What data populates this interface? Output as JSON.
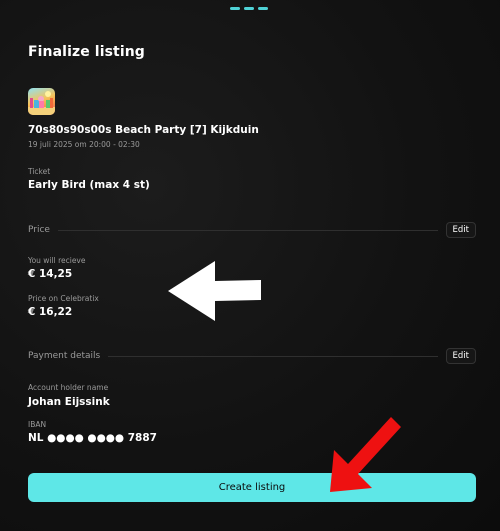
{
  "sheet": {
    "title": "Finalize listing"
  },
  "event": {
    "name": "70s80s90s00s Beach Party [7] Kijkduin",
    "date": "19 juli 2025 om 20:00 - 02:30"
  },
  "ticket": {
    "label": "Ticket",
    "value": "Early Bird (max 4 st)"
  },
  "price": {
    "section_title": "Price",
    "edit_label": "Edit",
    "receive_label": "You will recieve",
    "receive_value": "€ 14,25",
    "platform_label": "Price on Celebratix",
    "platform_value": "€ 16,22"
  },
  "payment": {
    "section_title": "Payment details",
    "edit_label": "Edit",
    "holder_label": "Account holder name",
    "holder_value": "Johan Eijssink",
    "iban_label": "IBAN",
    "iban_value": "NL ●●●● ●●●● 7887"
  },
  "actions": {
    "create_label": "Create listing"
  },
  "colors": {
    "accent": "#5ee7e7",
    "background": "#121212",
    "annotation_arrow_white": "#ffffff",
    "annotation_arrow_red": "#ee1111"
  }
}
